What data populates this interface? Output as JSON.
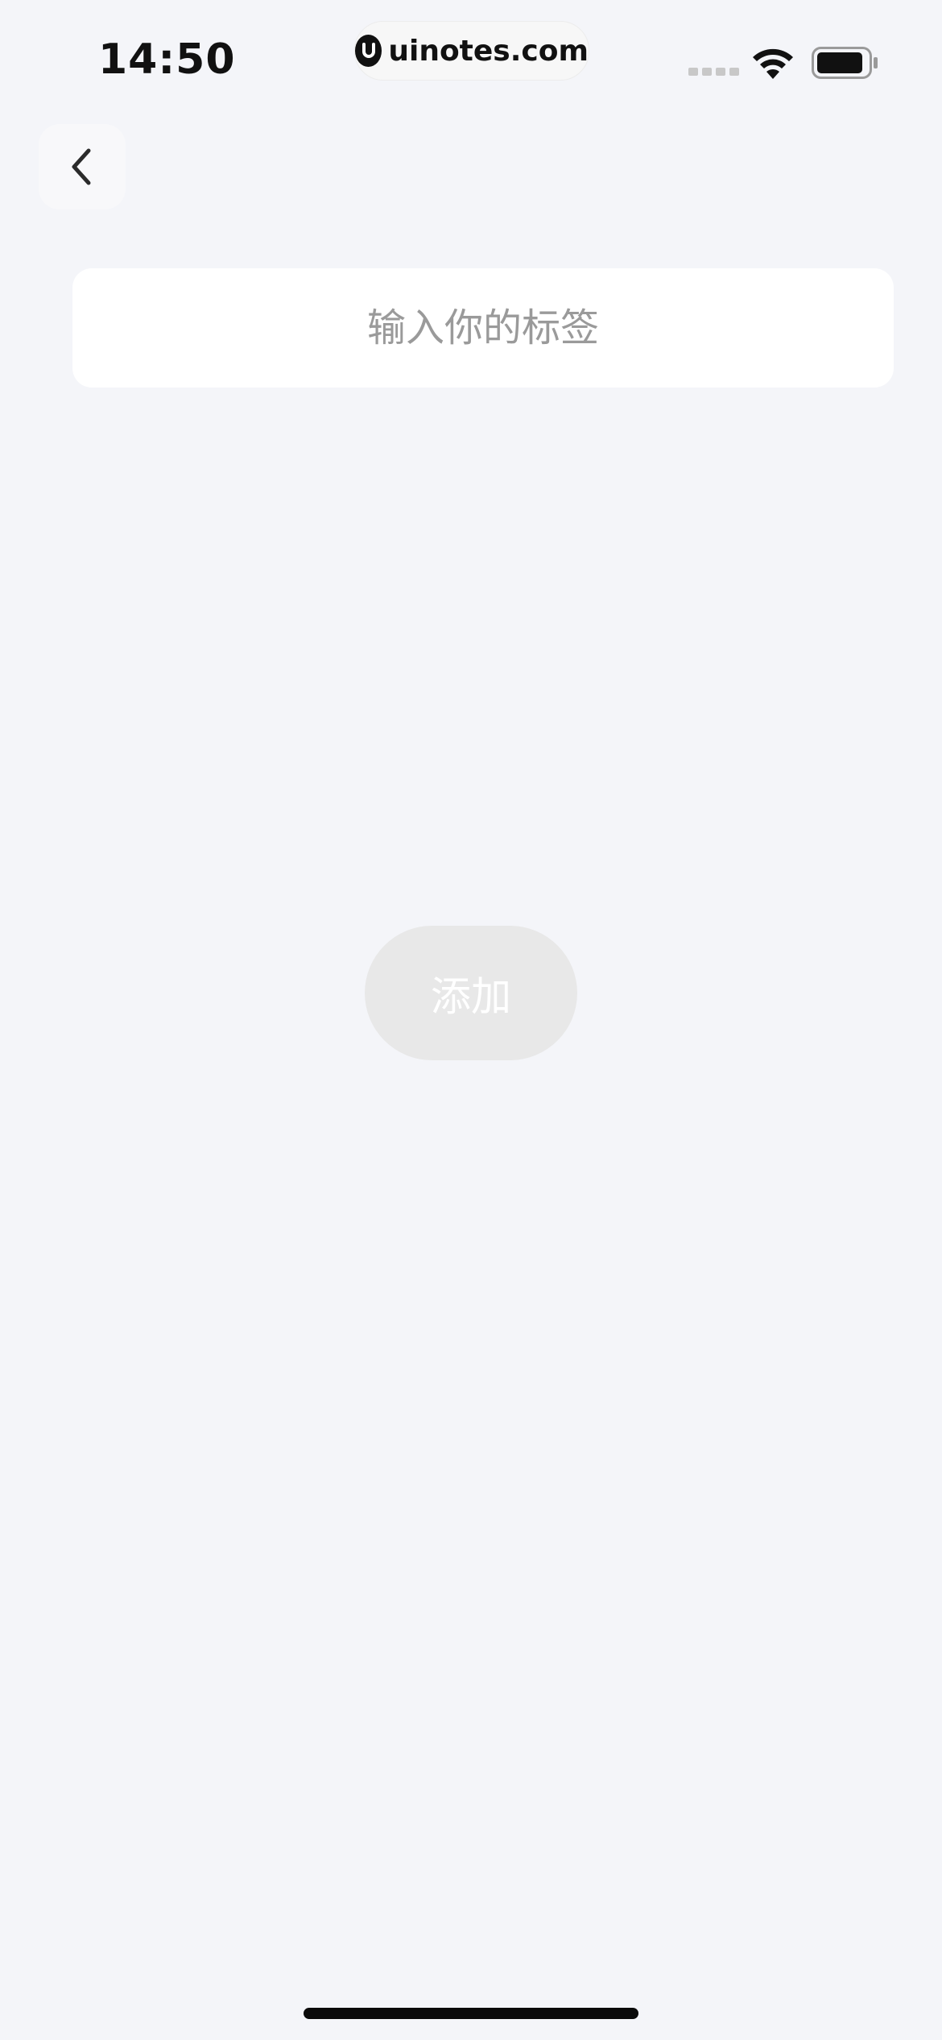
{
  "status_bar": {
    "time": "14:50",
    "watermark": "uinotes.com",
    "signal_icon": "cellular-signal-icon",
    "wifi_icon": "wifi-icon",
    "battery_icon": "battery-icon"
  },
  "nav": {
    "back_icon": "chevron-left-icon"
  },
  "form": {
    "tag_value": "",
    "tag_placeholder": "输入你的标签",
    "add_label": "添加"
  },
  "colors": {
    "background": "#f4f5f9",
    "input_background": "#ffffff",
    "placeholder": "#9a9a9a",
    "button_disabled": "#e8e8e8",
    "button_text": "#ffffff"
  }
}
